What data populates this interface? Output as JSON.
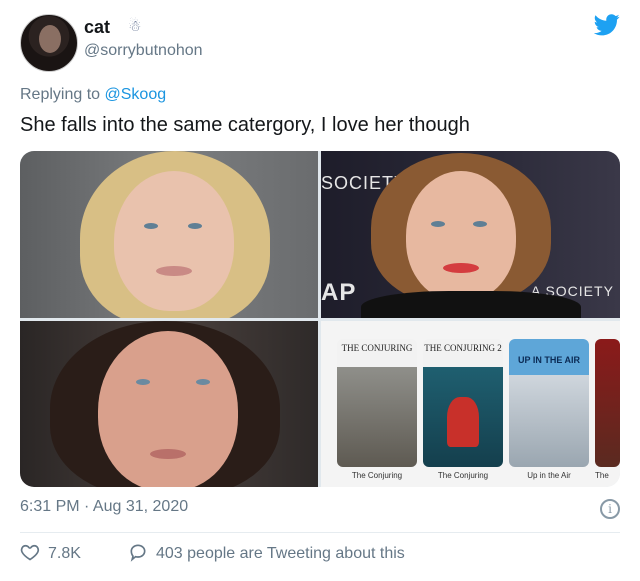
{
  "user": {
    "display_name": "cat",
    "handle": "@sorrybutnohon"
  },
  "reply": {
    "prefix": "Replying to",
    "mention": "@Skoog"
  },
  "tweet": {
    "text": "She falls into the same catergory, I love her though"
  },
  "media": {
    "photo2_backdrop": [
      "SOCIETY",
      "AP",
      "A SOCIETY"
    ],
    "posters": [
      {
        "title": "THE CONJURING",
        "caption": "The Conjuring"
      },
      {
        "title": "THE CONJURING 2",
        "caption": "The Conjuring"
      },
      {
        "title": "UP IN THE AIR",
        "caption": "Up in the Air"
      },
      {
        "title": "",
        "caption": "The"
      }
    ]
  },
  "meta": {
    "timestamp": "6:31 PM · Aug 31, 2020",
    "like_count": "7.8K",
    "tweeting": "403 people are Tweeting about this"
  },
  "colors": {
    "link": "#1b95e0",
    "muted": "#657786",
    "twitter_blue": "#1da1f2"
  }
}
